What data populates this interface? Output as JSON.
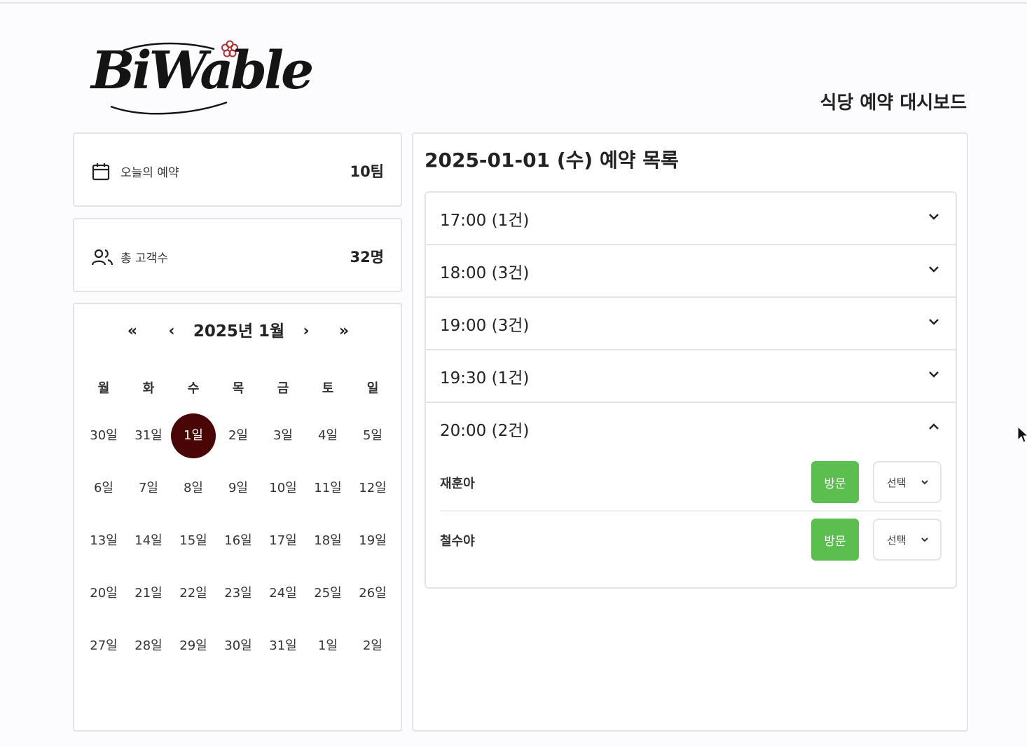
{
  "brand": {
    "logo_text": "BiWable"
  },
  "header": {
    "title": "식당 예약 대시보드"
  },
  "stats": [
    {
      "icon": "calendar-icon",
      "label": "오늘의 예약",
      "value": "10팀"
    },
    {
      "icon": "users-icon",
      "label": "총 고객수",
      "value": "32명"
    }
  ],
  "calendar": {
    "title": "2025년 1월",
    "nav": {
      "prev_year": "«",
      "prev_month": "‹",
      "next_month": "›",
      "next_year": "»"
    },
    "weekdays": [
      "월",
      "화",
      "수",
      "목",
      "금",
      "토",
      "일"
    ],
    "weeks": [
      [
        "30일",
        "31일",
        "1일",
        "2일",
        "3일",
        "4일",
        "5일"
      ],
      [
        "6일",
        "7일",
        "8일",
        "9일",
        "10일",
        "11일",
        "12일"
      ],
      [
        "13일",
        "14일",
        "15일",
        "16일",
        "17일",
        "18일",
        "19일"
      ],
      [
        "20일",
        "21일",
        "22일",
        "23일",
        "24일",
        "25일",
        "26일"
      ],
      [
        "27일",
        "28일",
        "29일",
        "30일",
        "31일",
        "1일",
        "2일"
      ]
    ],
    "selected": "1일",
    "selected_color": "#4a0606"
  },
  "reservations": {
    "title": "2025-01-01 (수) 예약 목록",
    "slots": [
      {
        "label": "17:00 (1건)",
        "expanded": false,
        "entries": []
      },
      {
        "label": "18:00 (3건)",
        "expanded": false,
        "entries": []
      },
      {
        "label": "19:00 (3건)",
        "expanded": false,
        "entries": []
      },
      {
        "label": "19:30 (1건)",
        "expanded": false,
        "entries": []
      },
      {
        "label": "20:00 (2건)",
        "expanded": true,
        "entries": [
          {
            "name": "재훈아",
            "visit_label": "방문",
            "select_label": "선택"
          },
          {
            "name": "철수야",
            "visit_label": "방문",
            "select_label": "선택"
          }
        ]
      }
    ],
    "visit_color": "#5bbf4f"
  }
}
